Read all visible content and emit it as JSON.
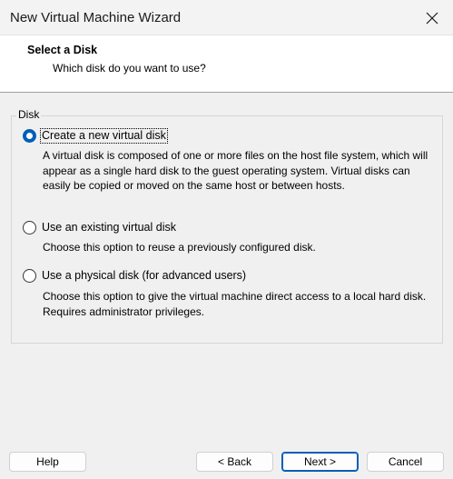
{
  "window": {
    "title": "New Virtual Machine Wizard"
  },
  "header": {
    "title": "Select a Disk",
    "subtitle": "Which disk do you want to use?"
  },
  "disk_group": {
    "label": "Disk",
    "options": [
      {
        "label": "Create a new virtual disk",
        "selected": true,
        "description": "A virtual disk is composed of one or more files on the host file system, which will appear as a single hard disk to the guest operating system. Virtual disks can easily be copied or moved on the same host or between hosts."
      },
      {
        "label": "Use an existing virtual disk",
        "selected": false,
        "description": "Choose this option to reuse a previously configured disk."
      },
      {
        "label": "Use a physical disk (for advanced users)",
        "selected": false,
        "description": "Choose this option to give the virtual machine direct access to a local hard disk. Requires administrator privileges."
      }
    ]
  },
  "buttons": {
    "help": "Help",
    "back": "< Back",
    "next": "Next >",
    "cancel": "Cancel"
  },
  "colors": {
    "accent": "#005fb8",
    "background": "#f0f0f0",
    "header_background": "#ffffff"
  },
  "icons": {
    "close": "close-icon"
  }
}
